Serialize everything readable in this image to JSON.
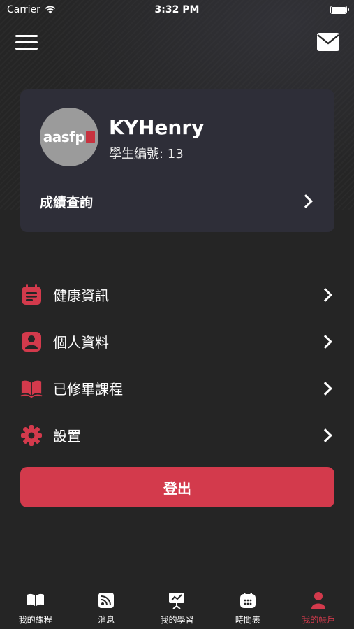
{
  "status": {
    "carrier": "Carrier",
    "time": "3:32 PM"
  },
  "profile": {
    "avatar_text": "aasfp",
    "name": "KYHenry",
    "student_id": "學生編號: 13",
    "grades_label": "成績查詢"
  },
  "menu": {
    "items": [
      {
        "label": "健康資訊",
        "icon": "health-info-icon"
      },
      {
        "label": "個人資料",
        "icon": "profile-icon"
      },
      {
        "label": "已修畢課程",
        "icon": "book-icon"
      },
      {
        "label": "設置",
        "icon": "gear-icon"
      }
    ]
  },
  "logout_label": "登出",
  "tabs": [
    {
      "label": "我的課程",
      "icon": "book-icon",
      "active": false
    },
    {
      "label": "消息",
      "icon": "rss-icon",
      "active": false
    },
    {
      "label": "我的學習",
      "icon": "presentation-icon",
      "active": false
    },
    {
      "label": "時間表",
      "icon": "calendar-icon",
      "active": false
    },
    {
      "label": "我的帳戶",
      "icon": "user-icon",
      "active": true
    }
  ],
  "colors": {
    "accent": "#d33a4c",
    "background": "#252525",
    "card": "#2e2e38"
  }
}
